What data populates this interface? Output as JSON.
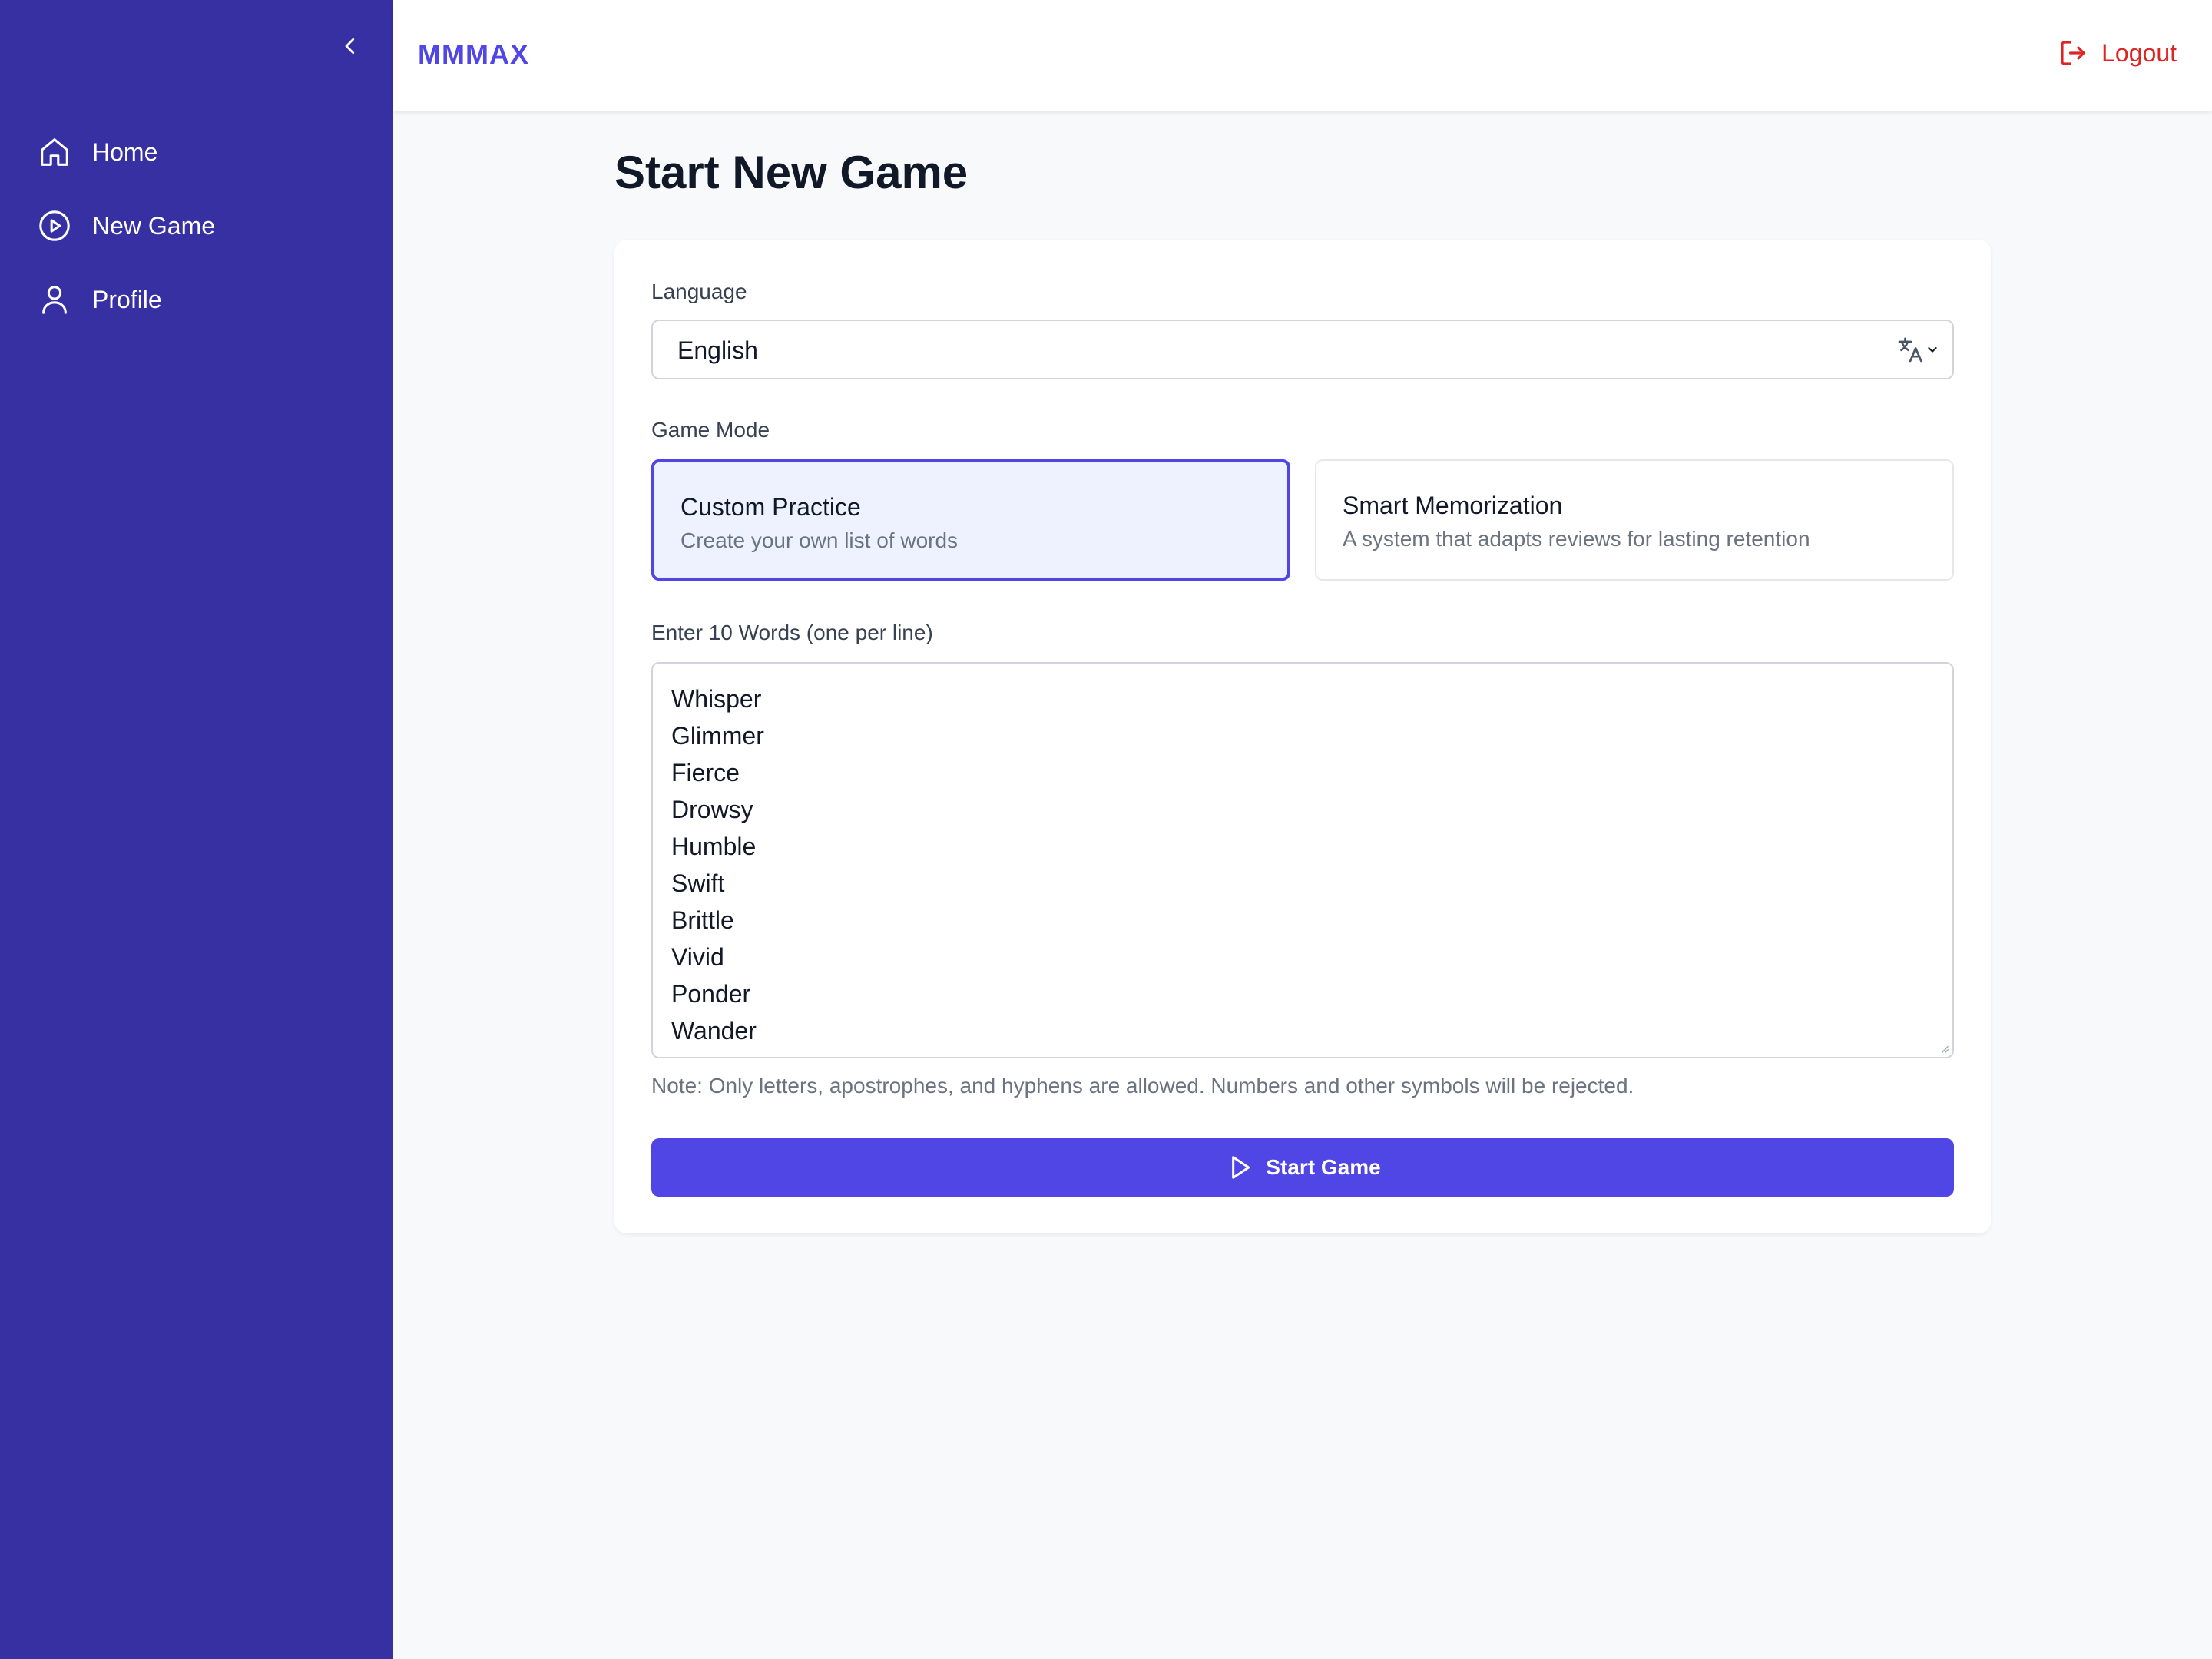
{
  "app": {
    "brand": "MMMAX"
  },
  "sidebar": {
    "items": [
      {
        "label": "Home",
        "icon": "home-icon"
      },
      {
        "label": "New Game",
        "icon": "play-circle-icon"
      },
      {
        "label": "Profile",
        "icon": "user-icon"
      }
    ]
  },
  "header": {
    "logout_label": "Logout"
  },
  "main": {
    "title": "Start New Game",
    "language": {
      "label": "Language",
      "value": "English"
    },
    "game_mode": {
      "label": "Game Mode",
      "options": [
        {
          "title": "Custom Practice",
          "description": "Create your own list of words",
          "selected": true
        },
        {
          "title": "Smart Memorization",
          "description": "A system that adapts reviews for lasting retention",
          "selected": false
        }
      ]
    },
    "words": {
      "label": "Enter 10 Words (one per line)",
      "values": [
        "Whisper",
        "Glimmer",
        "Fierce",
        "Drowsy",
        "Humble",
        "Swift",
        "Brittle",
        "Vivid",
        "Ponder",
        "Wander"
      ]
    },
    "note": "Note: Only letters, apostrophes, and hyphens are allowed. Numbers and other symbols will be rejected.",
    "start_label": "Start Game"
  },
  "colors": {
    "sidebar_bg": "#3730a3",
    "accent": "#4f46e5",
    "danger": "#dc2626",
    "page_bg": "#f8f9fb"
  }
}
